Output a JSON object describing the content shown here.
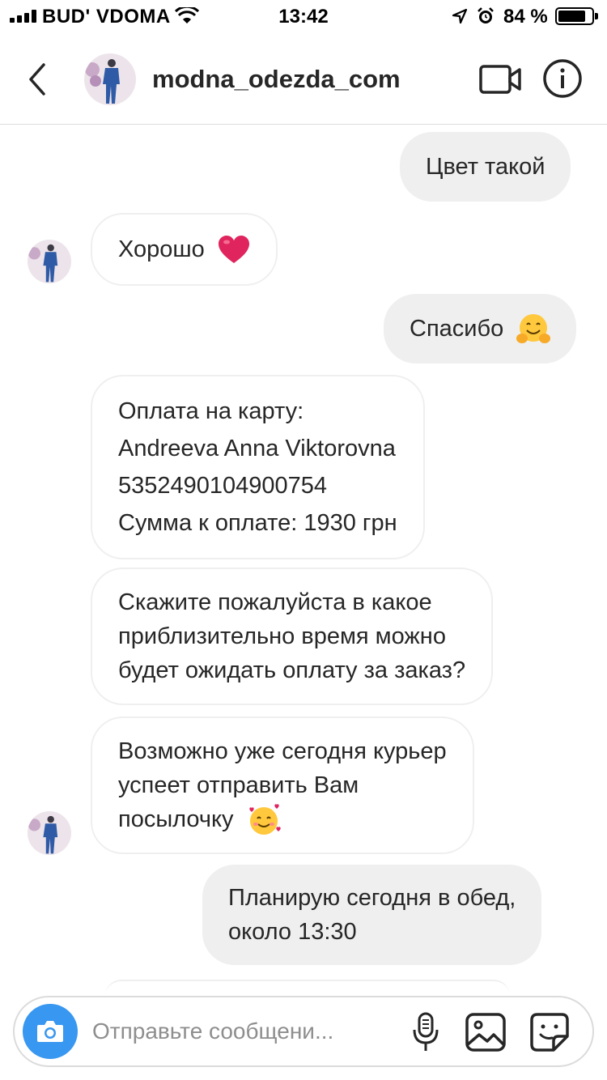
{
  "status_bar": {
    "carrier": "BUD' VDOMA",
    "time": "13:42",
    "battery_percent": "84 %",
    "battery_level": 0.84
  },
  "header": {
    "username": "modna_odezda_com",
    "icons": [
      "back-chevron-icon",
      "video-call-icon",
      "info-icon"
    ]
  },
  "messages": [
    {
      "direction": "outgoing",
      "text": "Цвет такой"
    },
    {
      "direction": "incoming",
      "text": "Хорошо",
      "emoji": "red-heart"
    },
    {
      "direction": "outgoing",
      "text": "Спасибо",
      "emoji": "hugging-face"
    },
    {
      "direction": "incoming",
      "lines": [
        "Оплата на карту:",
        "Andreeva Anna Viktorovna",
        "5352490104900754",
        "Сумма к оплате: 1930 грн"
      ]
    },
    {
      "direction": "incoming",
      "lines": [
        "Скажите пожалуйста в какое",
        "приблизительно время можно",
        "будет ожидать оплату за заказ?"
      ]
    },
    {
      "direction": "incoming",
      "lines": [
        "Возможно уже сегодня курьер",
        "успеет отправить Вам",
        "посылочку"
      ],
      "emoji": "smiling-face-with-hearts"
    },
    {
      "direction": "outgoing",
      "lines": [
        "Планирую сегодня в обед,",
        "около 13:30"
      ]
    }
  ],
  "composer": {
    "placeholder": "Отправьте сообщени...",
    "value": "",
    "icons": [
      "camera-icon",
      "microphone-icon",
      "gallery-icon",
      "sticker-icon"
    ]
  },
  "colors": {
    "accent_blue": "#3897f0",
    "bubble_out": "#efefef",
    "bubble_in_border": "#efefef",
    "heart_red": "#e0245e"
  }
}
